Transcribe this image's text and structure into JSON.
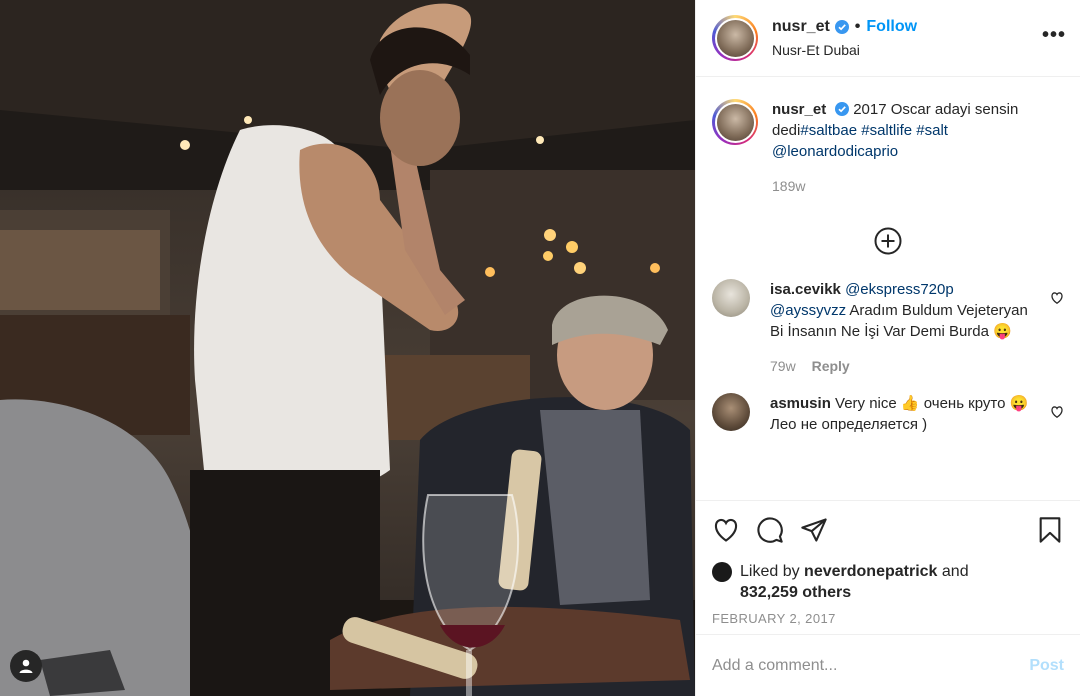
{
  "post": {
    "photo_alt": "Photo by nusr_et",
    "tag_icon": "user-icon"
  },
  "header": {
    "username": "nusr_et",
    "verified": true,
    "separator": "•",
    "follow_label": "Follow",
    "location": "Nusr-Et Dubai",
    "more_icon": "more-horizontal-icon",
    "more_label": "•••"
  },
  "caption": {
    "username": "nusr_et",
    "text": "2017 Oscar adayi sensin dedi",
    "hashtags": [
      "#saltbae",
      "#saltlife",
      "#salt"
    ],
    "mention": "@leonardodicaprio",
    "age": "189w"
  },
  "load_more_icon": "plus-circle-icon",
  "comments": [
    {
      "username": "isa.cevikk",
      "mention1": "@ekspress720p",
      "mention2": "@ayssyvzz",
      "text": "Aradım Buldum Vejeteryan Bi İnsanın Ne İşi Var Demi Burda 😛",
      "age": "79w",
      "reply_label": "Reply"
    },
    {
      "username": "asmusin",
      "text": "Very nice 👍 очень круто 😛 Лео не определяется )"
    }
  ],
  "actions": {
    "like_icon": "heart-icon",
    "comment_icon": "comment-icon",
    "share_icon": "paper-plane-icon",
    "save_icon": "bookmark-icon"
  },
  "likes": {
    "prefix": "Liked by",
    "liker": "neverdonepatrick",
    "conjunction": "and",
    "others": "832,259 others"
  },
  "date": "FEBRUARY 2, 2017",
  "add_comment": {
    "placeholder": "Add a comment...",
    "post_label": "Post"
  },
  "colors": {
    "link": "#0095f6",
    "hashtag": "#00376b",
    "muted": "#8e8e8e",
    "post_disabled": "#b2dffc"
  }
}
